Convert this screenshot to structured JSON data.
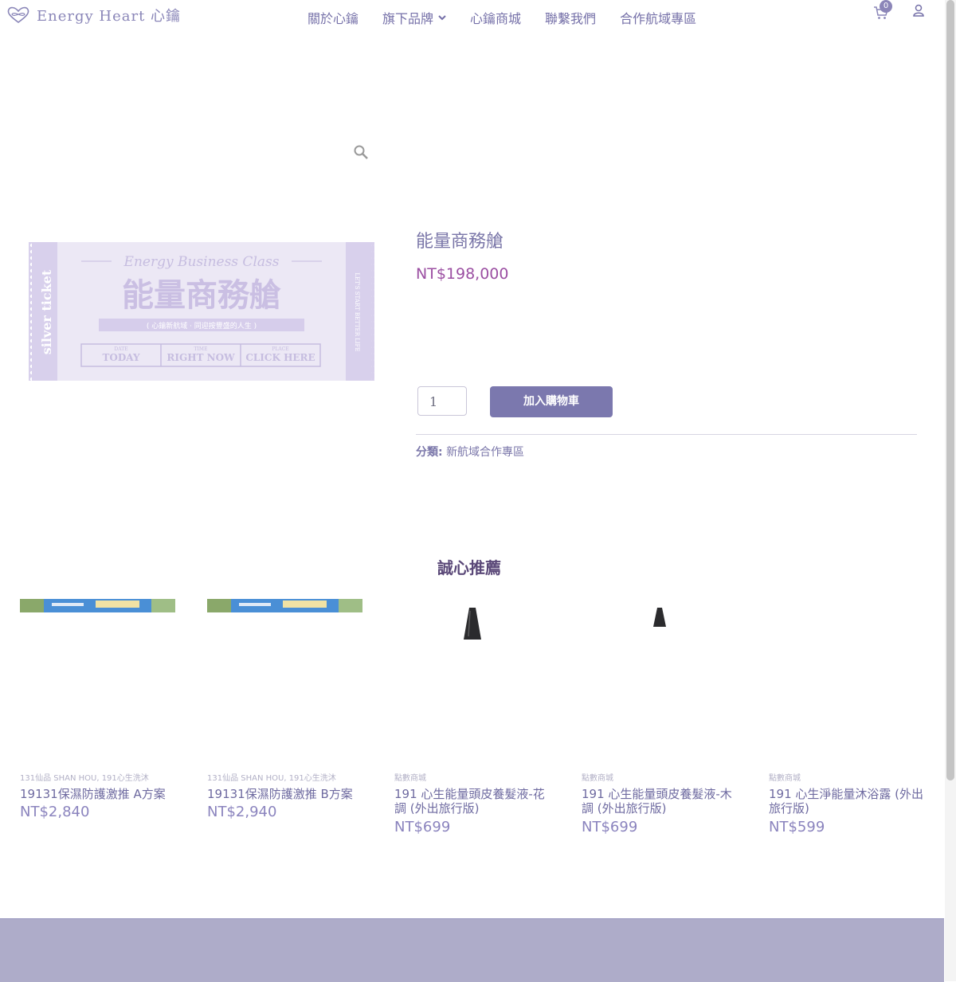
{
  "brand": {
    "name": "Energy Heart 心鑰"
  },
  "nav": {
    "items": [
      {
        "label": "關於心鑰"
      },
      {
        "label": "旗下品牌",
        "has_dropdown": true
      },
      {
        "label": "心鑰商城"
      },
      {
        "label": "聯繫我們"
      },
      {
        "label": "合作航域專區"
      }
    ]
  },
  "cart": {
    "count": "0"
  },
  "product": {
    "title": "能量商務艙",
    "price": "NT$198,000",
    "quantity": "1",
    "add_to_cart_label": "加入購物車",
    "category_label": "分類:",
    "category_value": "新航域合作專區",
    "image": {
      "script": "Energy Business Class",
      "main": "能量商務艙",
      "side_left": "silver ticket",
      "side_right": "LET'S START BETTER LIFE",
      "tagline": "( 心鑰新航域 · 同迎按豐盛的人生 )",
      "fields": [
        {
          "label": "DATE",
          "value": "TODAY"
        },
        {
          "label": "TIME",
          "value": "RIGHT NOW"
        },
        {
          "label": "PLACE",
          "value": "CLICK HERE"
        }
      ]
    }
  },
  "recommended": {
    "title": "誠心推薦",
    "items": [
      {
        "categories": "131仙品 SHAN HOU, 191心生洗沐",
        "name": "19131保濕防護激推 A方案",
        "price": "NT$2,840",
        "thumb": "banner"
      },
      {
        "categories": "131仙品 SHAN HOU, 191心生洗沐",
        "name": "19131保濕防護激推 B方案",
        "price": "NT$2,940",
        "thumb": "banner"
      },
      {
        "categories": "點數商城",
        "name": "191 心生能量頭皮養髮液-花調 (外出旅行版)",
        "price": "NT$699",
        "thumb": "bottle"
      },
      {
        "categories": "點數商城",
        "name": "191 心生能量頭皮養髮液-木調 (外出旅行版)",
        "price": "NT$699",
        "thumb": "bottle"
      },
      {
        "categories": "點數商城",
        "name": "191 心生淨能量沐浴露 (外出旅行版)",
        "price": "NT$599",
        "thumb": "none"
      }
    ]
  },
  "colors": {
    "accent": "#7b78ae",
    "price": "#9b4fa2",
    "footer": "#aeacc9"
  }
}
